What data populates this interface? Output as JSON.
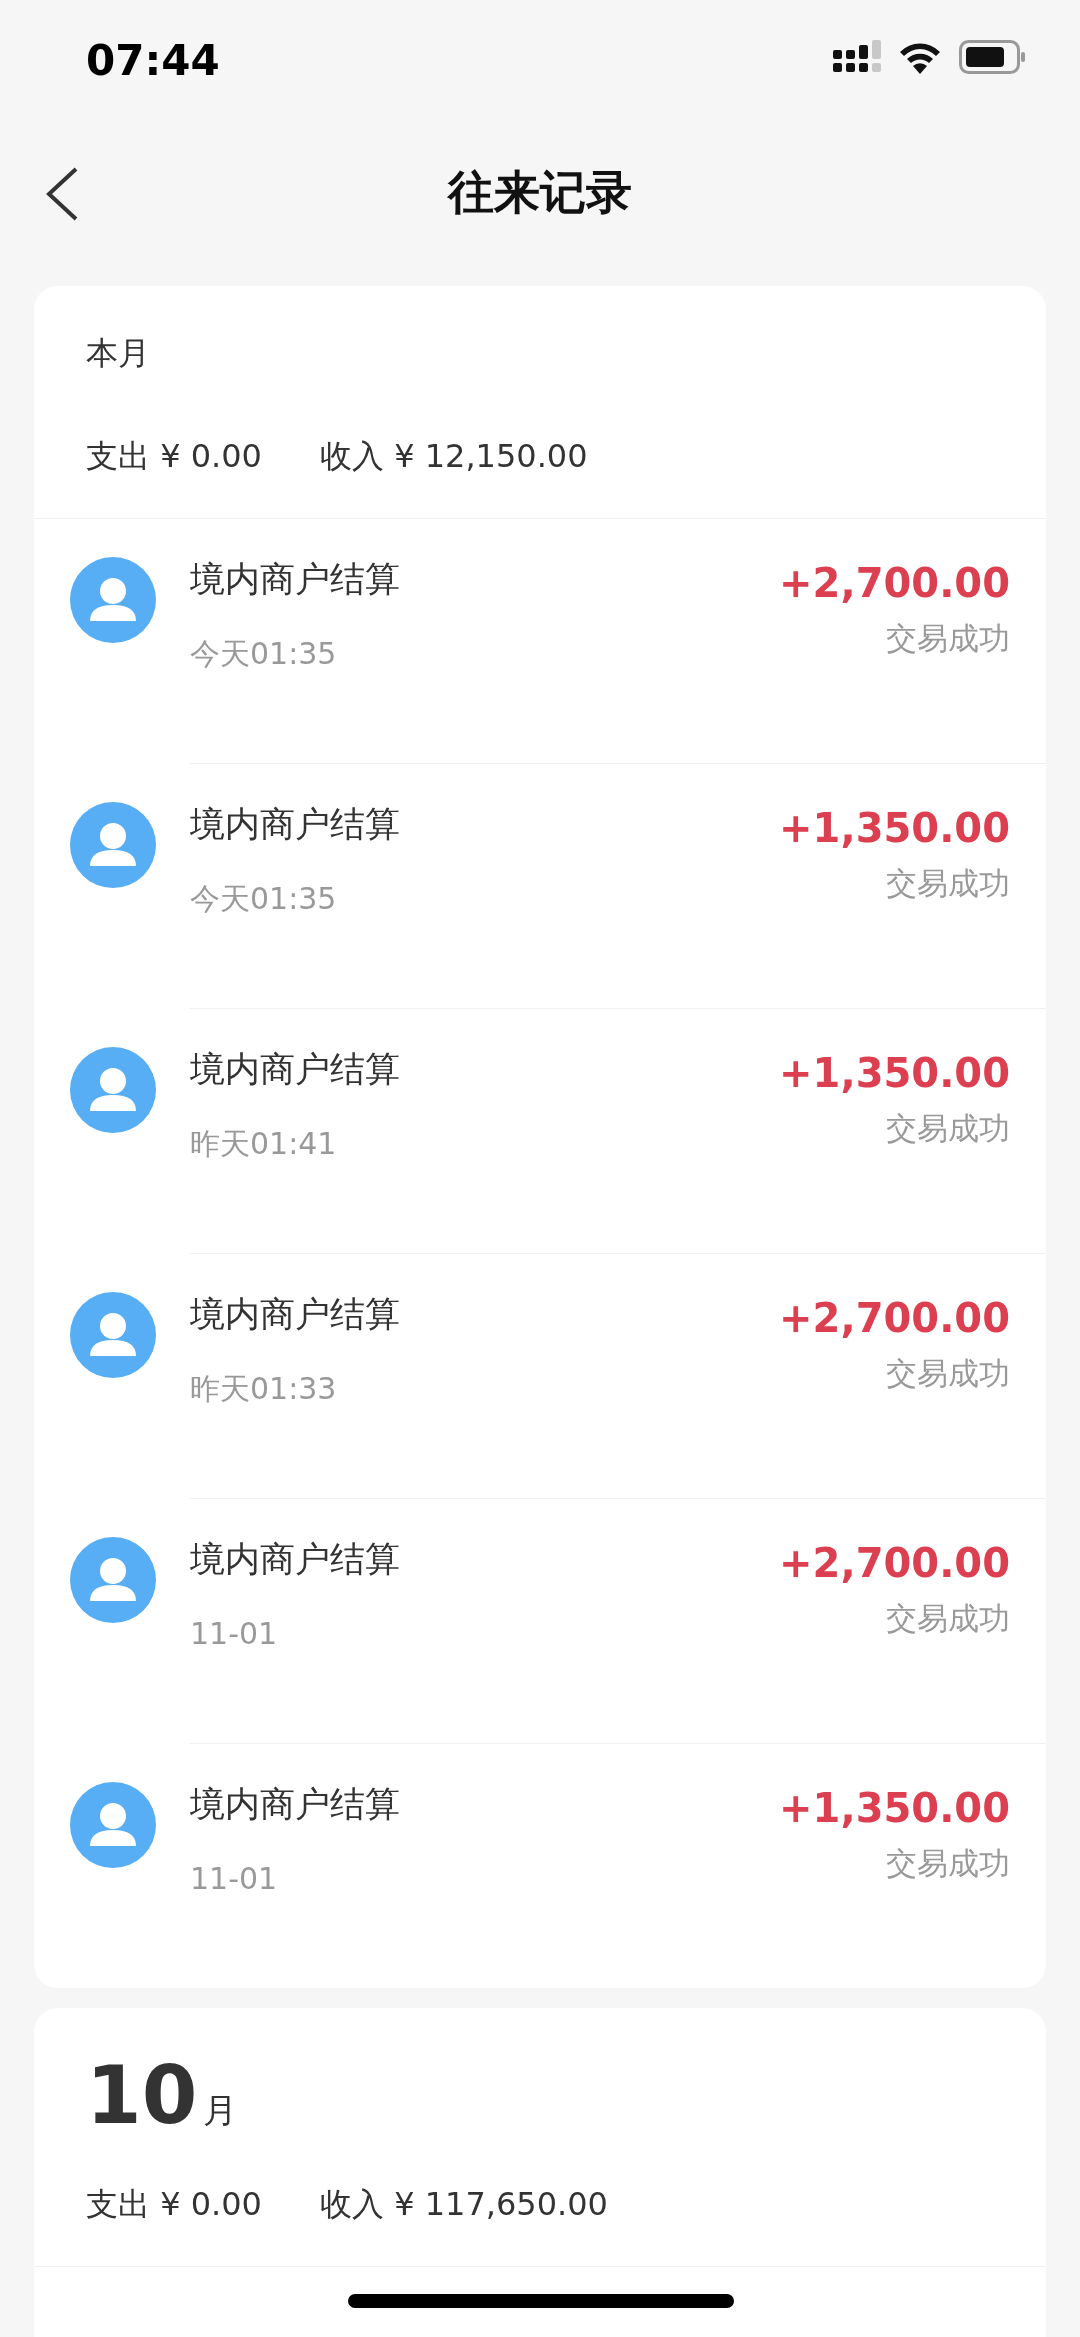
{
  "status_bar": {
    "time": "07:44"
  },
  "header": {
    "title": "往来记录"
  },
  "months": [
    {
      "kind": "current",
      "label": "本月",
      "expense": "支出 ¥ 0.00",
      "income": "收入 ¥ 12,150.00",
      "records": [
        {
          "name": "境内商户结算",
          "time": "今天01:35",
          "amount": "+2,700.00",
          "status": "交易成功"
        },
        {
          "name": "境内商户结算",
          "time": "今天01:35",
          "amount": "+1,350.00",
          "status": "交易成功"
        },
        {
          "name": "境内商户结算",
          "time": "昨天01:41",
          "amount": "+1,350.00",
          "status": "交易成功"
        },
        {
          "name": "境内商户结算",
          "time": "昨天01:33",
          "amount": "+2,700.00",
          "status": "交易成功"
        },
        {
          "name": "境内商户结算",
          "time": "11-01",
          "amount": "+2,700.00",
          "status": "交易成功"
        },
        {
          "name": "境内商户结算",
          "time": "11-01",
          "amount": "+1,350.00",
          "status": "交易成功"
        }
      ]
    },
    {
      "kind": "past",
      "number": "10",
      "unit": "月",
      "expense": "支出 ¥ 0.00",
      "income": "收入 ¥ 117,650.00"
    }
  ]
}
